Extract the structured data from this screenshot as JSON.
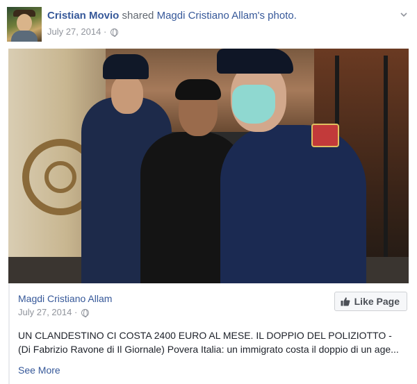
{
  "post": {
    "author": "Cristian Movio",
    "action": "shared",
    "shared_from": "Magdi Cristiano Allam's photo.",
    "date": "July 27, 2014",
    "separator": "·",
    "privacy_icon": "globe-icon",
    "menu_icon": "chevron-down-icon"
  },
  "attachment": {
    "source_name": "Magdi Cristiano Allam",
    "source_date": "July 27, 2014",
    "separator": "·",
    "privacy_icon": "globe-icon",
    "like_button_label": "Like Page",
    "like_icon": "thumbs-up-icon",
    "text": "UN CLANDESTINO CI COSTA 2400 EURO AL MESE. IL DOPPIO DEL POLIZIOTTO - (Di Fabrizio Ravone di Il Giornale) Povera Italia: un immigrato costa il doppio di un age...",
    "see_more": "See More"
  },
  "colors": {
    "link": "#365899",
    "meta": "#90949c",
    "text": "#1d2129"
  }
}
